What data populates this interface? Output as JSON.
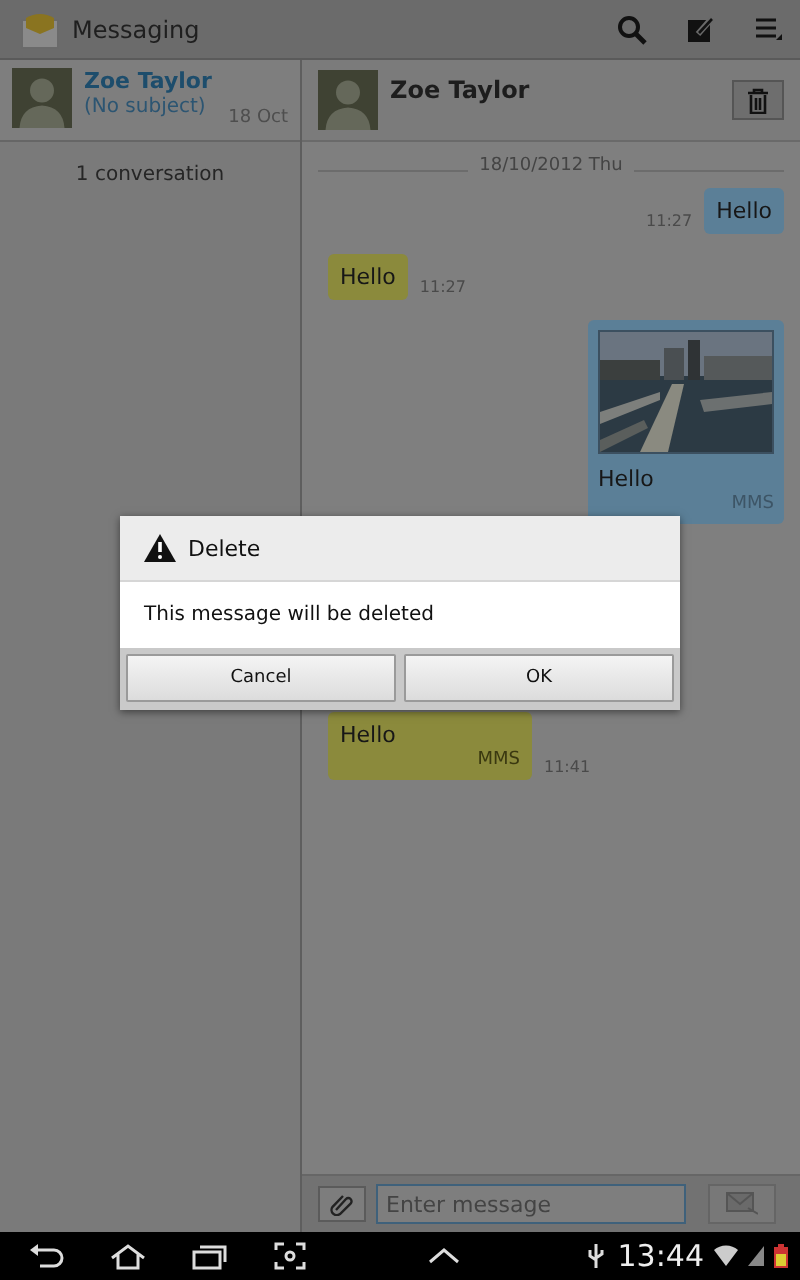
{
  "app_bar": {
    "title": "Messaging"
  },
  "conversations": [
    {
      "name": "Zoe Taylor",
      "subject": "(No subject)",
      "date": "18 Oct",
      "selected": true
    }
  ],
  "conversation_count": "1 conversation",
  "thread": {
    "contact": "Zoe Taylor",
    "date_divider": "18/10/2012 Thu",
    "messages": [
      {
        "kind": "sent",
        "text": "Hello",
        "time": "11:27"
      },
      {
        "kind": "received",
        "text": "Hello",
        "time": "11:27"
      },
      {
        "kind": "sent",
        "text": "Hello",
        "tag": "MMS"
      },
      {
        "kind": "received",
        "text": "Hello",
        "tag": "MMS",
        "time": "11:41"
      }
    ],
    "input": {
      "placeholder": "Enter message"
    }
  },
  "dialog": {
    "title": "Delete",
    "message": "This message will be deleted",
    "buttons": [
      "Cancel",
      "OK"
    ]
  },
  "status_bar": {
    "time": "13:44"
  }
}
